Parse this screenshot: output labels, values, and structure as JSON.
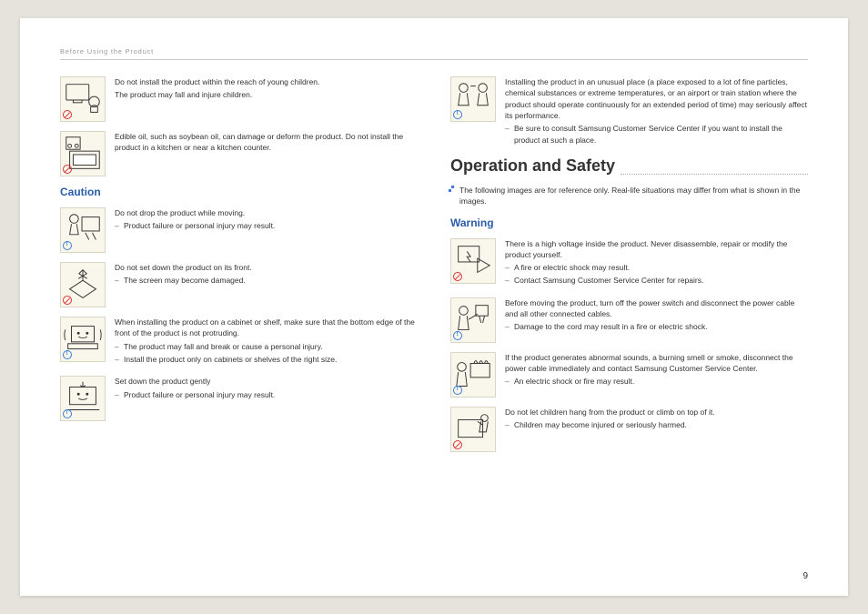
{
  "header": {
    "breadcrumb": "Before Using the Product"
  },
  "page_number": "9",
  "left": {
    "items": [
      {
        "main": "Do not install the product within the reach of young children.",
        "sub": "The product may fall and injure children.",
        "badge": "prohibit"
      },
      {
        "main": "Edible oil, such as soybean oil, can damage or deform the product. Do not install the product in a kitchen or near a kitchen counter.",
        "badge": "prohibit"
      }
    ],
    "caution_title": "Caution",
    "caution_items": [
      {
        "main": "Do not drop the product while moving.",
        "subs": [
          "Product failure or personal injury may result."
        ],
        "badge": "info"
      },
      {
        "main": "Do not set down the product on its front.",
        "subs": [
          "The screen may become damaged."
        ],
        "badge": "prohibit"
      },
      {
        "main": "When installing the product on a cabinet or shelf, make sure that the bottom edge of the front of the product is not protruding.",
        "subs": [
          "The product may fall and break or cause a personal injury.",
          "Install the product only on cabinets or shelves of the right size."
        ],
        "badge": "info"
      },
      {
        "main": "Set down the product gently",
        "subs": [
          "Product failure or personal injury may result."
        ],
        "badge": "info"
      }
    ]
  },
  "right": {
    "top_item": {
      "main": "Installing the product in an unusual place (a place exposed to a lot of fine particles, chemical substances or extreme temperatures, or an airport or train station where the product should operate continuously for an extended period of time) may seriously affect its performance.",
      "subs": [
        "Be sure to consult Samsung Customer Service Center if you want to install the product at such a place."
      ],
      "badge": "info"
    },
    "section_title": "Operation and Safety",
    "note": "The following images are for reference only. Real-life situations may differ from what is shown in the images.",
    "warning_title": "Warning",
    "warning_items": [
      {
        "main": "There is a high voltage inside the product. Never disassemble, repair or modify the product yourself.",
        "subs": [
          "A fire or electric shock may result.",
          "Contact Samsung Customer Service Center for repairs."
        ],
        "badge": "prohibit"
      },
      {
        "main": "Before moving the product, turn off the power switch and disconnect the power cable and all other connected cables.",
        "subs": [
          "Damage to the cord may result in a fire or electric shock."
        ],
        "badge": "info"
      },
      {
        "main": "If the product generates abnormal sounds, a burning smell or smoke, disconnect the power cable immediately and contact Samsung Customer Service Center.",
        "subs": [
          "An electric shock or fire may result."
        ],
        "badge": "info"
      },
      {
        "main": "Do not let children hang from the product or climb on top of it.",
        "subs": [
          "Children may become injured or seriously harmed."
        ],
        "badge": "prohibit"
      }
    ]
  }
}
